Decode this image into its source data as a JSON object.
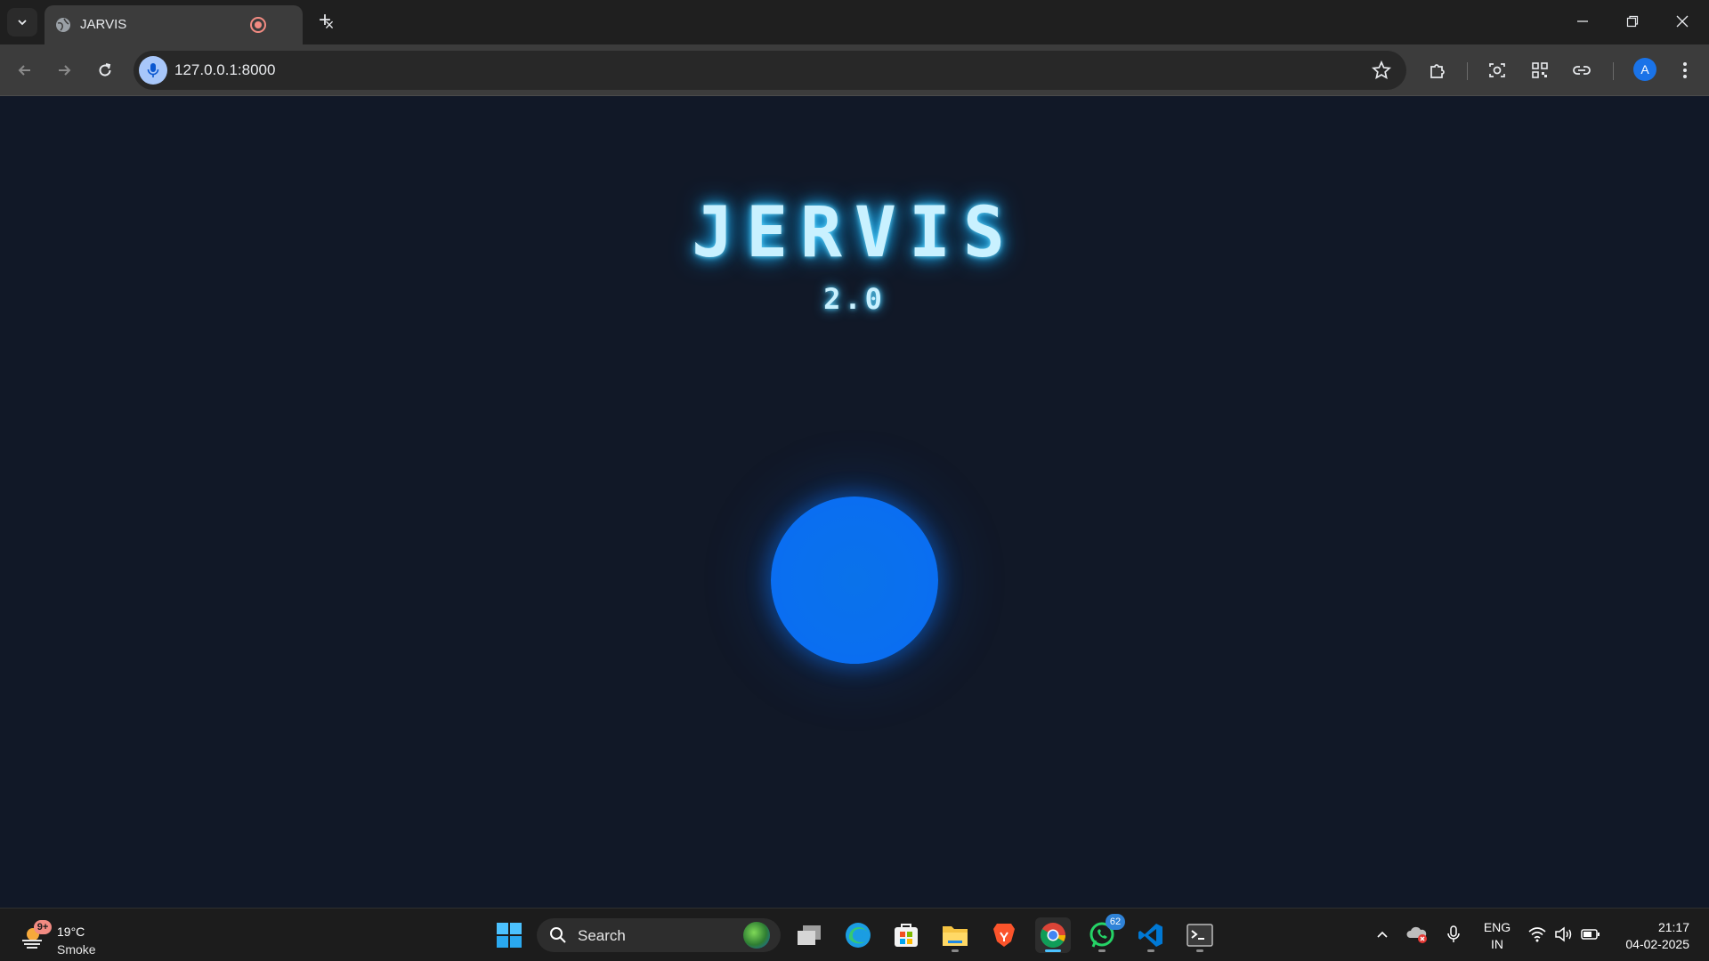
{
  "browser": {
    "tab_title": "JARVIS",
    "new_tab_label": "+",
    "tab_close_label": "×",
    "url": "127.0.0.1:8000",
    "profile_initial": "A"
  },
  "page": {
    "logo_title": "JERVIS",
    "logo_version": "2.0",
    "orb_color": "#0a6ff0",
    "background_color": "#111827"
  },
  "taskbar": {
    "weather": {
      "badge": "9+",
      "temp": "19°C",
      "condition": "Smoke"
    },
    "search_placeholder": "Search",
    "whatsapp_badge": "62",
    "language": {
      "line1": "ENG",
      "line2": "IN"
    },
    "clock": {
      "time": "21:17",
      "date": "04-02-2025"
    },
    "pinned_apps": [
      "task-view-icon",
      "edge-icon",
      "store-icon",
      "file-explorer-icon",
      "brave-icon",
      "chrome-icon",
      "whatsapp-icon",
      "vscode-icon",
      "terminal-icon"
    ]
  }
}
